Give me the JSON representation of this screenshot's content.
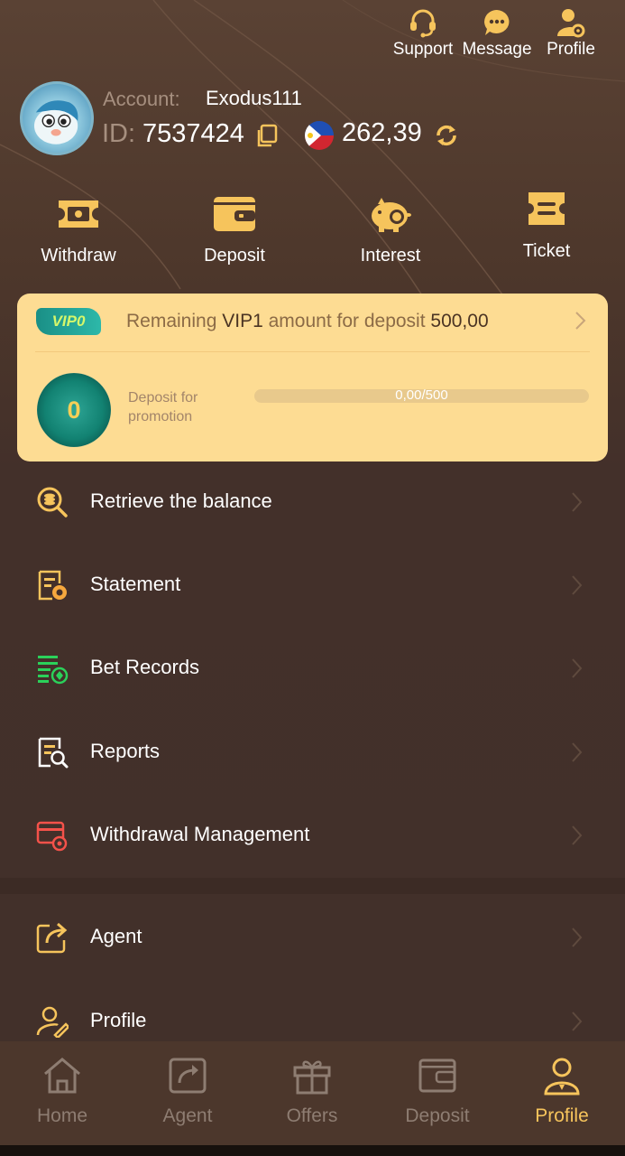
{
  "colors": {
    "accent": "#f6c45c",
    "card": "#fddc93",
    "text_muted": "#a68f7f"
  },
  "top_actions": [
    {
      "label": "Support",
      "icon": "headset-icon"
    },
    {
      "label": "Message",
      "icon": "chat-bubble-icon"
    },
    {
      "label": "Profile",
      "icon": "user-gear-icon"
    }
  ],
  "account": {
    "label": "Account:",
    "name": "Exodus111",
    "id_label": "ID:",
    "id": "7537424",
    "balance": "262,39"
  },
  "quick_actions": [
    {
      "label": "Withdraw",
      "icon": "cash-icon"
    },
    {
      "label": "Deposit",
      "icon": "wallet-icon"
    },
    {
      "label": "Interest",
      "icon": "piggy-bank-icon"
    },
    {
      "label": "Ticket",
      "icon": "ticket-icon"
    }
  ],
  "vip": {
    "badge": "VIP0",
    "text_prefix": "Remaining",
    "level": "VIP1",
    "text_mid": "amount for deposit",
    "amount": "500,00",
    "coin_level": "0",
    "promo_label": "Deposit for promotion",
    "progress_text": "0,00/500",
    "progress_fraction": 0
  },
  "menu": [
    {
      "label": "Retrieve the balance",
      "icon": "retrieve-balance-icon"
    },
    {
      "label": "Statement",
      "icon": "statement-icon"
    },
    {
      "label": "Bet Records",
      "icon": "bet-records-icon"
    },
    {
      "label": "Reports",
      "icon": "reports-icon"
    },
    {
      "label": "Withdrawal Management",
      "icon": "withdrawal-management-icon"
    },
    {
      "label": "Agent",
      "icon": "share-icon"
    },
    {
      "label": "Profile",
      "icon": "user-edit-icon"
    }
  ],
  "nav": [
    {
      "label": "Home",
      "icon": "home-icon"
    },
    {
      "label": "Agent",
      "icon": "share-icon"
    },
    {
      "label": "Offers",
      "icon": "gift-icon"
    },
    {
      "label": "Deposit",
      "icon": "wallet-icon"
    },
    {
      "label": "Profile",
      "icon": "user-icon",
      "active": true
    }
  ]
}
